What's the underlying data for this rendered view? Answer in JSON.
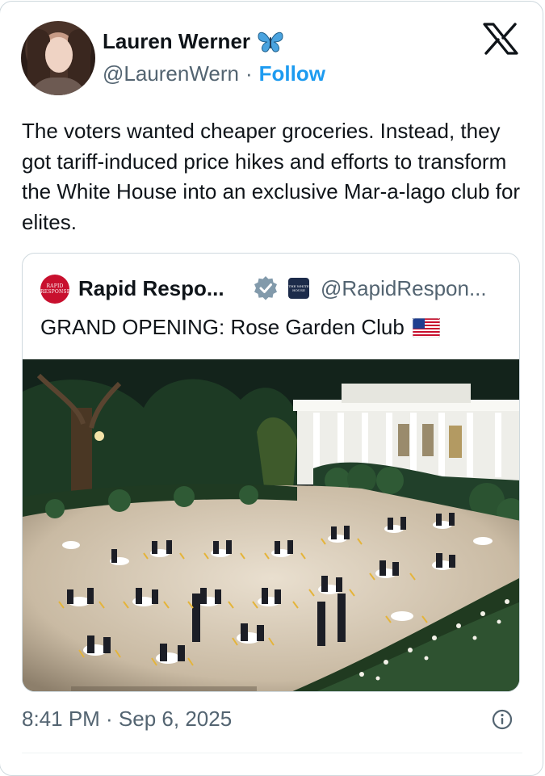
{
  "author": {
    "name": "Lauren Werner",
    "handle": "@LaurenWern",
    "separator": "·",
    "follow_label": "Follow",
    "name_emoji_icon": "butterfly-icon"
  },
  "platform_icon": "x-logo-icon",
  "tweet": {
    "text": "The voters wanted cheaper groceries. Instead, they got tariff-induced price hikes and efforts to transform the White House into an exclusive Mar-a-lago club for elites."
  },
  "quote": {
    "avatar_text": "RAPID RESPONSE",
    "name": "Rapid Respo...",
    "verified_icon": "verified-badge-icon",
    "affiliate_badge_text": "THE WHITE HOUSE",
    "handle": "@RapidRespon...",
    "text": "GRAND OPENING: Rose Garden Club",
    "flag_icon": "us-flag-icon"
  },
  "footer": {
    "timestamp": "8:41 PM · Sep 6, 2025",
    "info_icon": "info-icon"
  },
  "colors": {
    "accent": "#1d9bf0",
    "secondary_text": "#536471",
    "border": "#cfd9de",
    "verified_badge": "#829aab"
  }
}
